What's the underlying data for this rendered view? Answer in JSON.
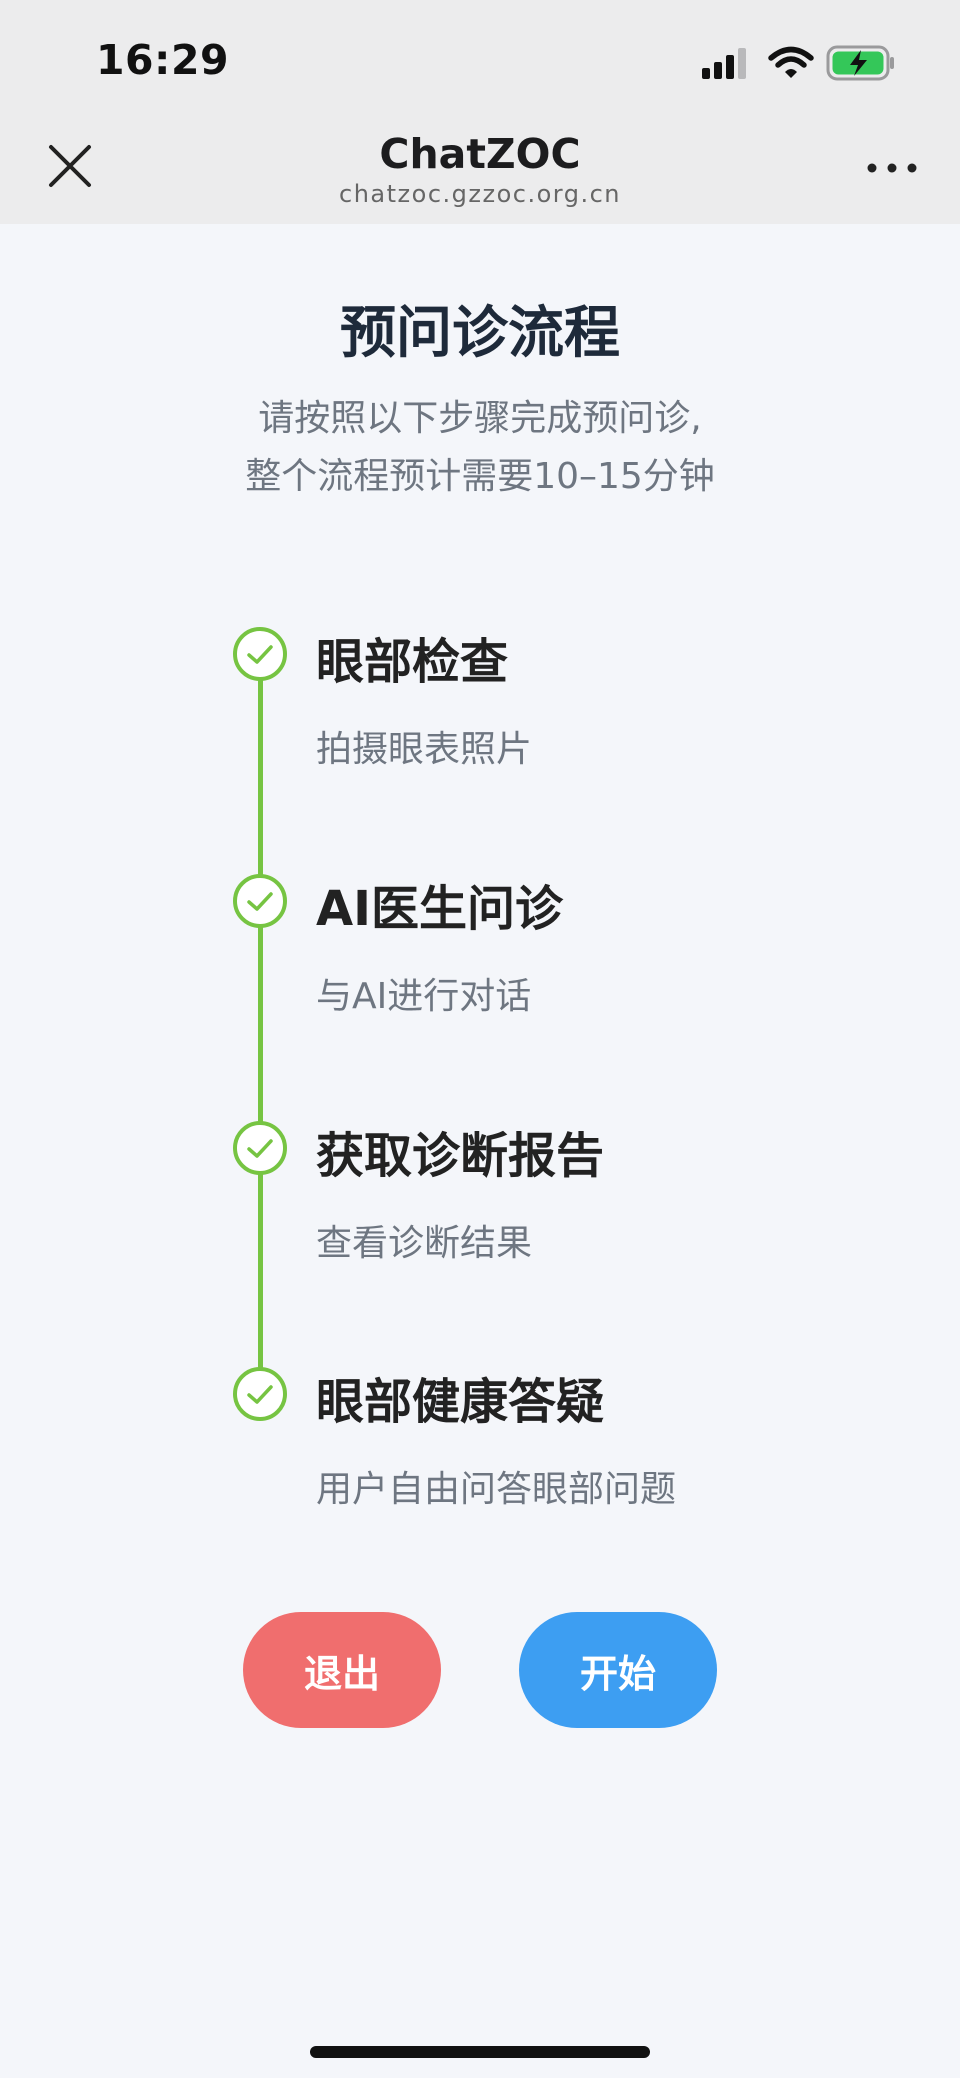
{
  "status_bar": {
    "time": "16:29",
    "icons": [
      "cellular-signal-icon",
      "wifi-icon",
      "battery-charging-icon"
    ]
  },
  "nav": {
    "title": "ChatZOC",
    "subtitle": "chatzoc.gzzoc.org.cn",
    "icons": [
      "close-icon",
      "more-icon"
    ]
  },
  "page": {
    "title": "预问诊流程",
    "desc_line1": "请按照以下步骤完成预问诊,",
    "desc_line2": "整个流程预计需要10–15分钟"
  },
  "steps": [
    {
      "title": "眼部检查",
      "desc": "拍摄眼表照片"
    },
    {
      "title": "AI医生问诊",
      "desc": "与AI进行对话"
    },
    {
      "title": "获取诊断报告",
      "desc": "查看诊断结果"
    },
    {
      "title": "眼部健康答疑",
      "desc": "用户自由问答眼部问题"
    }
  ],
  "buttons": {
    "exit_label": "退出",
    "start_label": "开始"
  },
  "colors": {
    "timeline_green": "#76c442",
    "exit_red": "#f06e6e",
    "start_blue": "#3d9ef2",
    "background": "#f4f6fa"
  }
}
